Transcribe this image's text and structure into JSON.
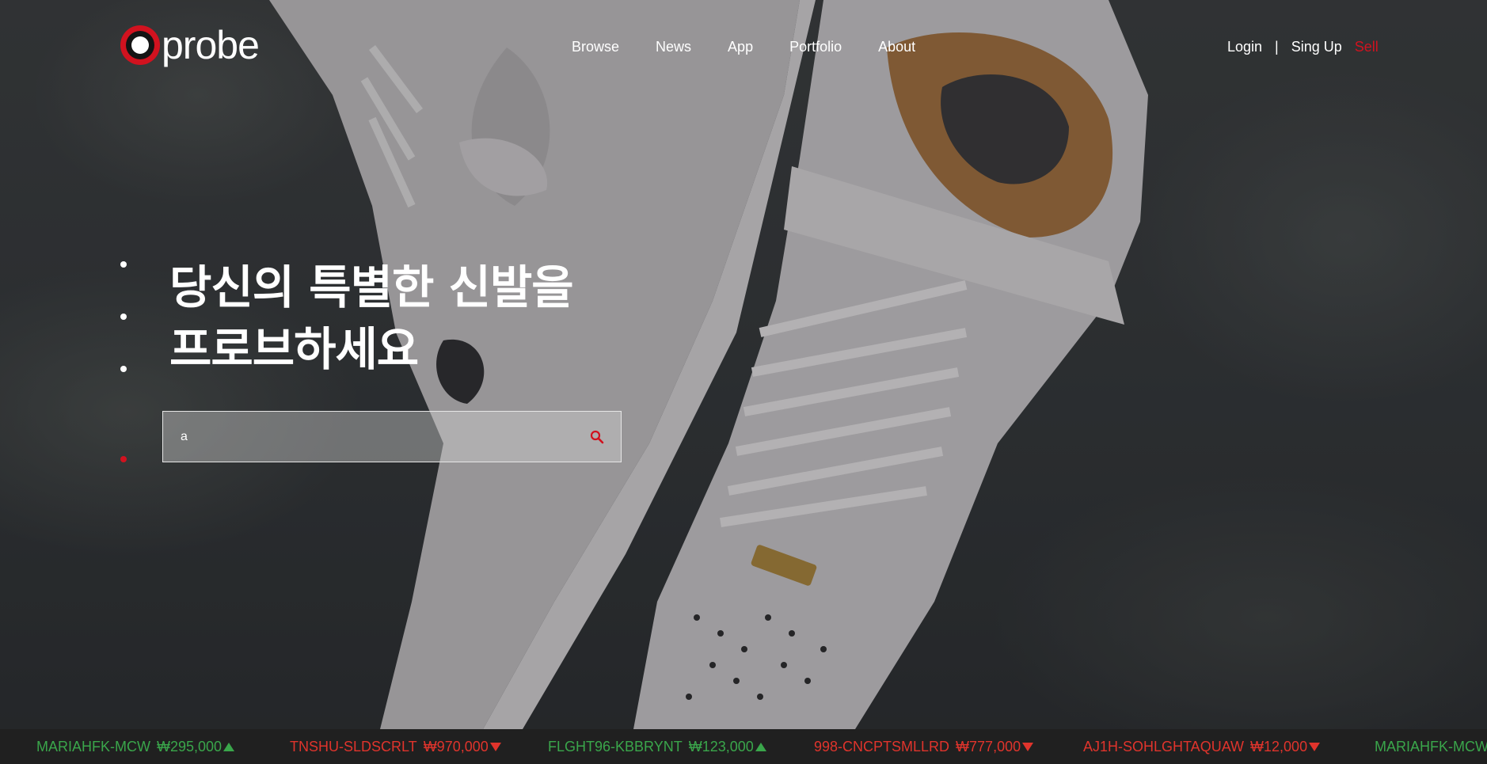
{
  "brand": {
    "logo_text": "probe",
    "logo_icon": "probe-ring-logo-icon",
    "accent_color": "#d1121f"
  },
  "main_nav": [
    {
      "label": "Browse"
    },
    {
      "label": "News"
    },
    {
      "label": "App"
    },
    {
      "label": "Portfolio"
    },
    {
      "label": "About"
    }
  ],
  "user_nav": {
    "login": "Login",
    "separator": "|",
    "signup": "Sing Up",
    "sell": "Sell"
  },
  "hero": {
    "headline_line1": "당신의 특별한 신발을",
    "headline_line2": "프로브하세요",
    "slide_count": 4,
    "active_slide": 4
  },
  "search": {
    "value": "a",
    "icon": "search-icon"
  },
  "ticker": {
    "up_color": "#3aa64b",
    "down_color": "#e0342c",
    "items": [
      {
        "symbol": "MARIAHFK-MCW",
        "price": "₩295,000",
        "direction": "up"
      },
      {
        "symbol": "TNSHU-SLDSCRLT",
        "price": "₩970,000",
        "direction": "down"
      },
      {
        "symbol": "FLGHT96-KBBRYNT",
        "price": "₩123,000",
        "direction": "up"
      },
      {
        "symbol": "998-CNCPTSMLLRD",
        "price": "₩777,000",
        "direction": "down"
      },
      {
        "symbol": "AJ1H-SOHLGHTAQUAW",
        "price": "₩12,000",
        "direction": "down"
      },
      {
        "symbol": "MARIAHFK-MCW",
        "price": "",
        "direction": "up"
      }
    ]
  }
}
